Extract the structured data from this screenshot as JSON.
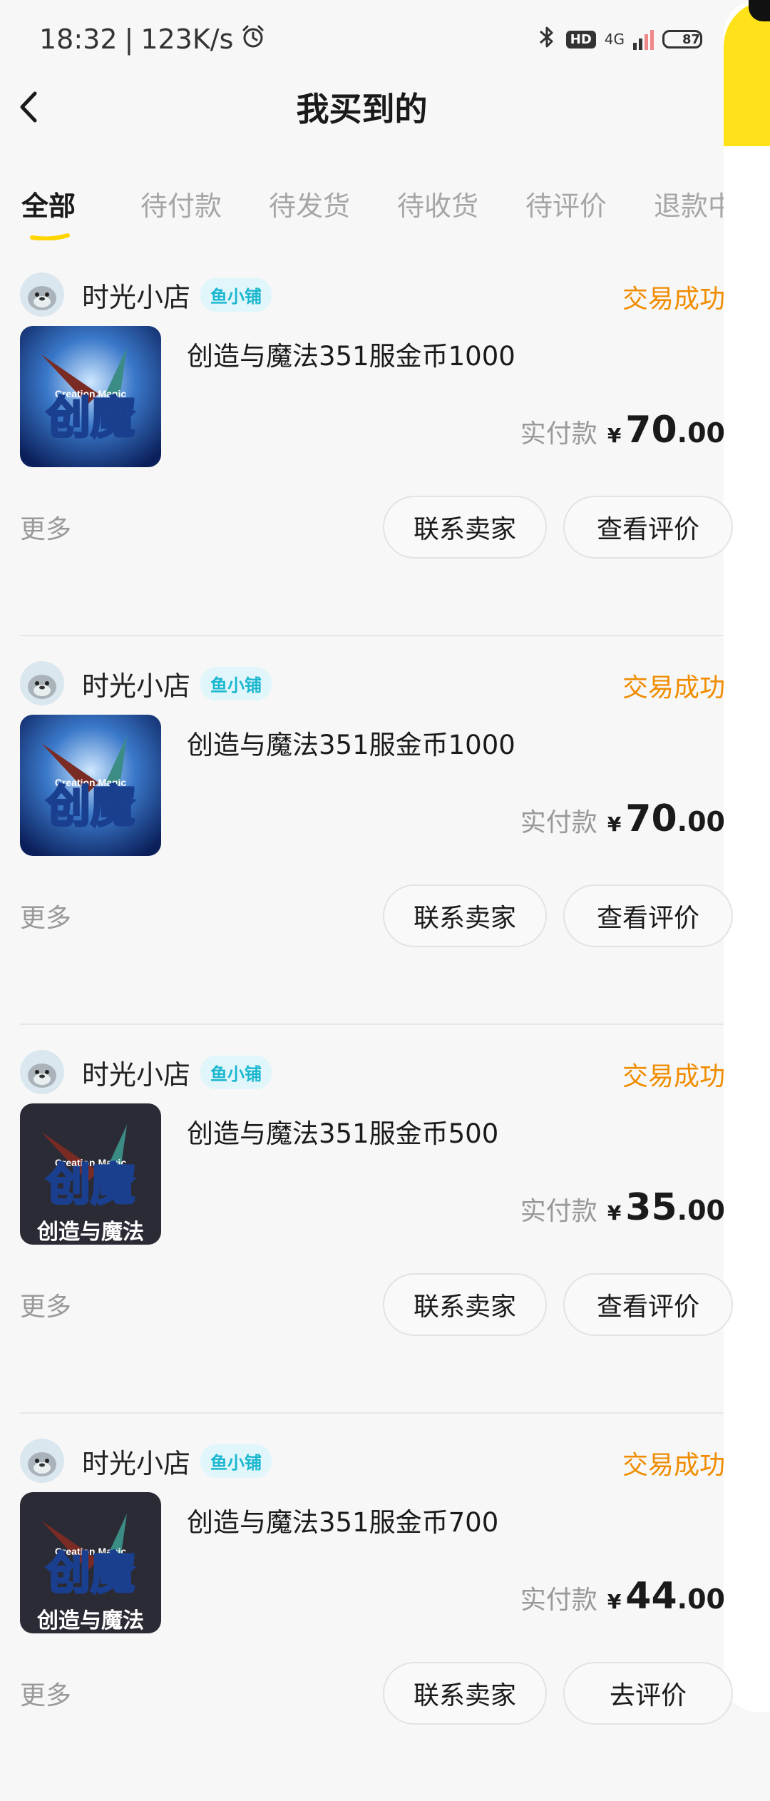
{
  "status_bar": {
    "time": "18:32",
    "separator": "|",
    "net_speed": "123K/s",
    "hd_label": "HD",
    "network_label": "4G",
    "battery": "87",
    "battery_level": 0.87
  },
  "header": {
    "title": "我买到的"
  },
  "tabs": [
    {
      "label": "全部",
      "active": true
    },
    {
      "label": "待付款",
      "active": false
    },
    {
      "label": "待发货",
      "active": false
    },
    {
      "label": "待收货",
      "active": false
    },
    {
      "label": "待评价",
      "active": false
    },
    {
      "label": "退款中",
      "active": false
    }
  ],
  "colors": {
    "accent_yellow": "#ffe21a",
    "status_orange": "#f08c00",
    "badge_cyan": "#1bb7cf"
  },
  "orders": [
    {
      "shop_name": "时光小店",
      "shop_badge": "鱼小铺",
      "status": "交易成功",
      "product_title": "创造与魔法351服金币1000",
      "price_label": "实付款",
      "currency": "¥",
      "price_int": "70",
      "price_dec": ".00",
      "more": "更多",
      "btn_contact": "联系卖家",
      "btn_review": "查看评价",
      "thumb_caption": ""
    },
    {
      "shop_name": "时光小店",
      "shop_badge": "鱼小铺",
      "status": "交易成功",
      "product_title": "创造与魔法351服金币1000",
      "price_label": "实付款",
      "currency": "¥",
      "price_int": "70",
      "price_dec": ".00",
      "more": "更多",
      "btn_contact": "联系卖家",
      "btn_review": "查看评价",
      "thumb_caption": ""
    },
    {
      "shop_name": "时光小店",
      "shop_badge": "鱼小铺",
      "status": "交易成功",
      "product_title": "创造与魔法351服金币500",
      "price_label": "实付款",
      "currency": "¥",
      "price_int": "35",
      "price_dec": ".00",
      "more": "更多",
      "btn_contact": "联系卖家",
      "btn_review": "查看评价",
      "thumb_caption": "创造与魔法"
    },
    {
      "shop_name": "时光小店",
      "shop_badge": "鱼小铺",
      "status": "交易成功",
      "product_title": "创造与魔法351服金币700",
      "price_label": "实付款",
      "currency": "¥",
      "price_int": "44",
      "price_dec": ".00",
      "more": "更多",
      "btn_contact": "联系卖家",
      "btn_review": "去评价",
      "thumb_caption": "创造与魔法"
    }
  ],
  "thumb_logo_text": "创魔",
  "thumb_logo_sub": "Creation Magic"
}
